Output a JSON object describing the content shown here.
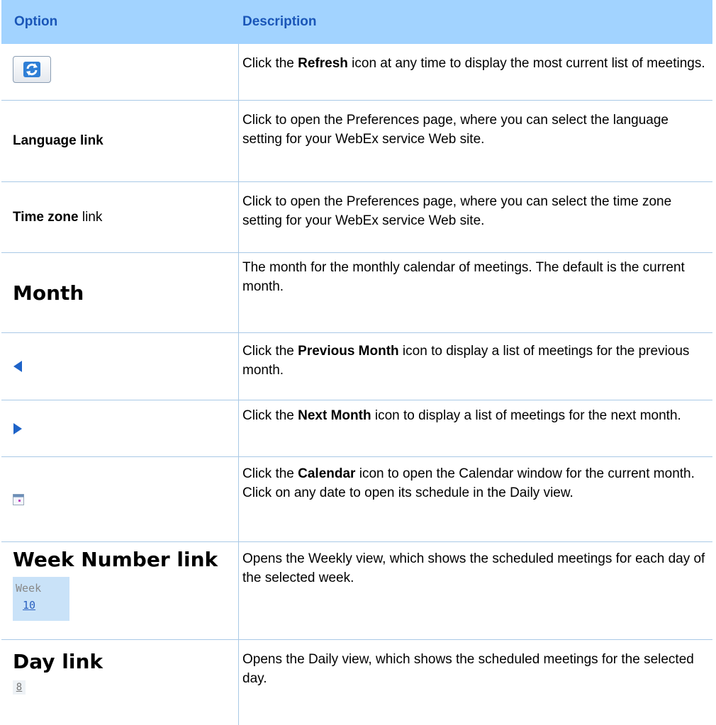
{
  "header": {
    "option": "Option",
    "description": "Description"
  },
  "rows": [
    {
      "option_icon": "refresh-icon",
      "desc": {
        "pre": "Click the ",
        "bold": "Refresh",
        "post": " icon at any time to display the most current list of meetings."
      }
    },
    {
      "option_bold": "Language link",
      "desc": {
        "text": "Click to open the Preferences page, where you can select the language setting for your WebEx service Web site."
      }
    },
    {
      "option_bold": "Time zone",
      "option_rest": " link",
      "desc": {
        "text": "Click to open the Preferences page, where you can select the time zone setting for your WebEx service Web site."
      }
    },
    {
      "option_big": "Month",
      "desc": {
        "text": "The month for the monthly calendar of meetings. The default is the current month."
      }
    },
    {
      "option_icon": "previous-month-arrow-icon",
      "desc": {
        "pre": "Click the ",
        "bold": "Previous Month",
        "post": " icon to display a list of meetings for the previous month."
      }
    },
    {
      "option_icon": "next-month-arrow-icon",
      "desc": {
        "pre": "Click the ",
        "bold": "Next Month",
        "post": " icon to display a list of meetings for the next month."
      }
    },
    {
      "option_icon": "calendar-icon",
      "desc": {
        "pre": "Click the ",
        "bold": "Calendar",
        "post": " icon to open the Calendar window for the current month. Click on any date to open its schedule in the Daily view."
      }
    },
    {
      "option_big": "Week Number link",
      "week_label": "Week",
      "week_number": "10",
      "desc": {
        "text": "Opens the Weekly view, which shows the scheduled meetings for each day of the selected week."
      }
    },
    {
      "option_big": "Day link",
      "day_number": "8",
      "desc": {
        "text": "Opens the Daily view, which shows the scheduled meetings for the selected day."
      }
    }
  ],
  "colors": {
    "header_bg": "#a2d3ff",
    "header_text": "#1a56b8",
    "border": "#a9c9e6",
    "arrow": "#1e63c8"
  }
}
